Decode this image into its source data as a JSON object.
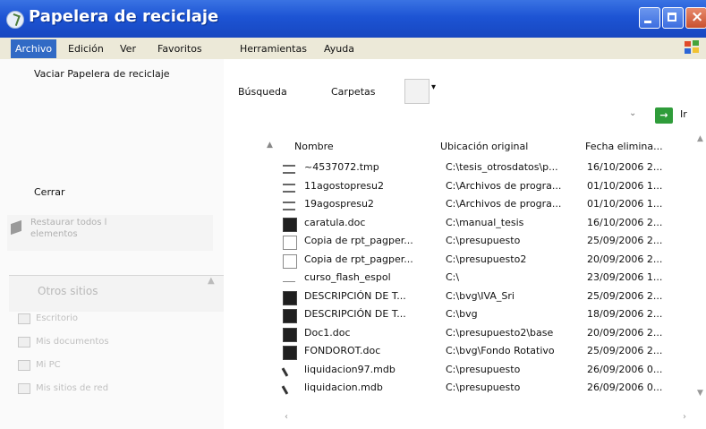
{
  "window": {
    "title": "Papelera de reciclaje"
  },
  "menubar": {
    "items": [
      "Archivo",
      "Edición",
      "Ver",
      "Favoritos",
      "Herramientas",
      "Ayuda"
    ],
    "active": "Archivo"
  },
  "file_menu": {
    "empty_bin": "Vaciar Papelera de reciclaje",
    "close": "Cerrar"
  },
  "toolbar": {
    "search": "Búsqueda",
    "folders": "Carpetas",
    "go": "Ir"
  },
  "left_panel": {
    "restore_all": "Restaurar todos l elementos",
    "other_places": {
      "title": "Otros sitios",
      "items": [
        "Escritorio",
        "Mis documentos",
        "Mi PC",
        "Mis sitios de red"
      ]
    }
  },
  "columns": [
    "Nombre",
    "Ubicación original",
    "Fecha elimina..."
  ],
  "files": [
    {
      "name": "~4537072.tmp",
      "location": "C:\\tesis_otrosdatos\\p...",
      "date": "16/10/2006 2...",
      "icon": "tmp-file-icon"
    },
    {
      "name": "11agostopresu2",
      "location": "C:\\Archivos de progra...",
      "date": "01/10/2006 1...",
      "icon": "tmp-file-icon"
    },
    {
      "name": "19agospresu2",
      "location": "C:\\Archivos de progra...",
      "date": "01/10/2006 1...",
      "icon": "tmp-file-icon"
    },
    {
      "name": "caratula.doc",
      "location": "C:\\manual_tesis",
      "date": "16/10/2006 2...",
      "icon": "word-doc-icon"
    },
    {
      "name": "Copia de rpt_pagper...",
      "location": "C:\\presupuesto",
      "date": "25/09/2006 2...",
      "icon": "document-icon"
    },
    {
      "name": "Copia de rpt_pagper...",
      "location": "C:\\presupuesto2",
      "date": "20/09/2006 2...",
      "icon": "document-icon"
    },
    {
      "name": "curso_flash_espol",
      "location": "C:\\",
      "date": "23/09/2006 1...",
      "icon": "generic-file-icon"
    },
    {
      "name": "DESCRIPCIÓN DE T...",
      "location": "C:\\bvg\\IVA_Sri",
      "date": "25/09/2006 2...",
      "icon": "word-doc-icon"
    },
    {
      "name": "DESCRIPCIÓN DE T...",
      "location": "C:\\bvg",
      "date": "18/09/2006 2...",
      "icon": "word-doc-icon"
    },
    {
      "name": "Doc1.doc",
      "location": "C:\\presupuesto2\\base",
      "date": "20/09/2006 2...",
      "icon": "word-doc-icon"
    },
    {
      "name": "FONDOROT.doc",
      "location": "C:\\bvg\\Fondo Rotativo",
      "date": "25/09/2006 2...",
      "icon": "word-doc-icon"
    },
    {
      "name": "liquidacion97.mdb",
      "location": "C:\\presupuesto",
      "date": "26/09/2006 0...",
      "icon": "access-db-icon"
    },
    {
      "name": "liquidacion.mdb",
      "location": "C:\\presupuesto",
      "date": "26/09/2006 0...",
      "icon": "access-db-icon"
    }
  ],
  "colors": {
    "titlebar": "#1d54d4",
    "menu_highlight": "#316ac5",
    "menubar": "#ece9d8",
    "go_button": "#2f9c3a"
  }
}
